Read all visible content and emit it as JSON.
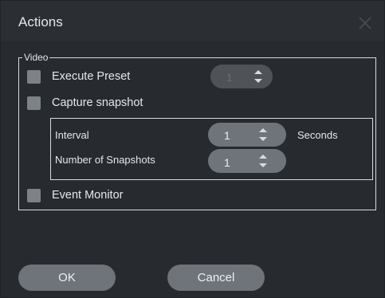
{
  "window": {
    "title": "Actions",
    "close_icon": "close-icon"
  },
  "video_group": {
    "legend": "Video",
    "execute_preset": {
      "label": "Execute Preset",
      "checked": false,
      "value": "1",
      "enabled": false
    },
    "capture_snapshot": {
      "label": "Capture snapshot",
      "checked": false,
      "interval_label": "Interval",
      "interval_value": "1",
      "interval_unit": "Seconds",
      "count_label": "Number of Snapshots",
      "count_value": "1"
    },
    "event_monitor": {
      "label": "Event Monitor",
      "checked": false
    }
  },
  "buttons": {
    "ok": "OK",
    "cancel": "Cancel"
  },
  "colors": {
    "background": "#272a2f",
    "control": "#6f747a",
    "text": "#e6e8ea"
  }
}
